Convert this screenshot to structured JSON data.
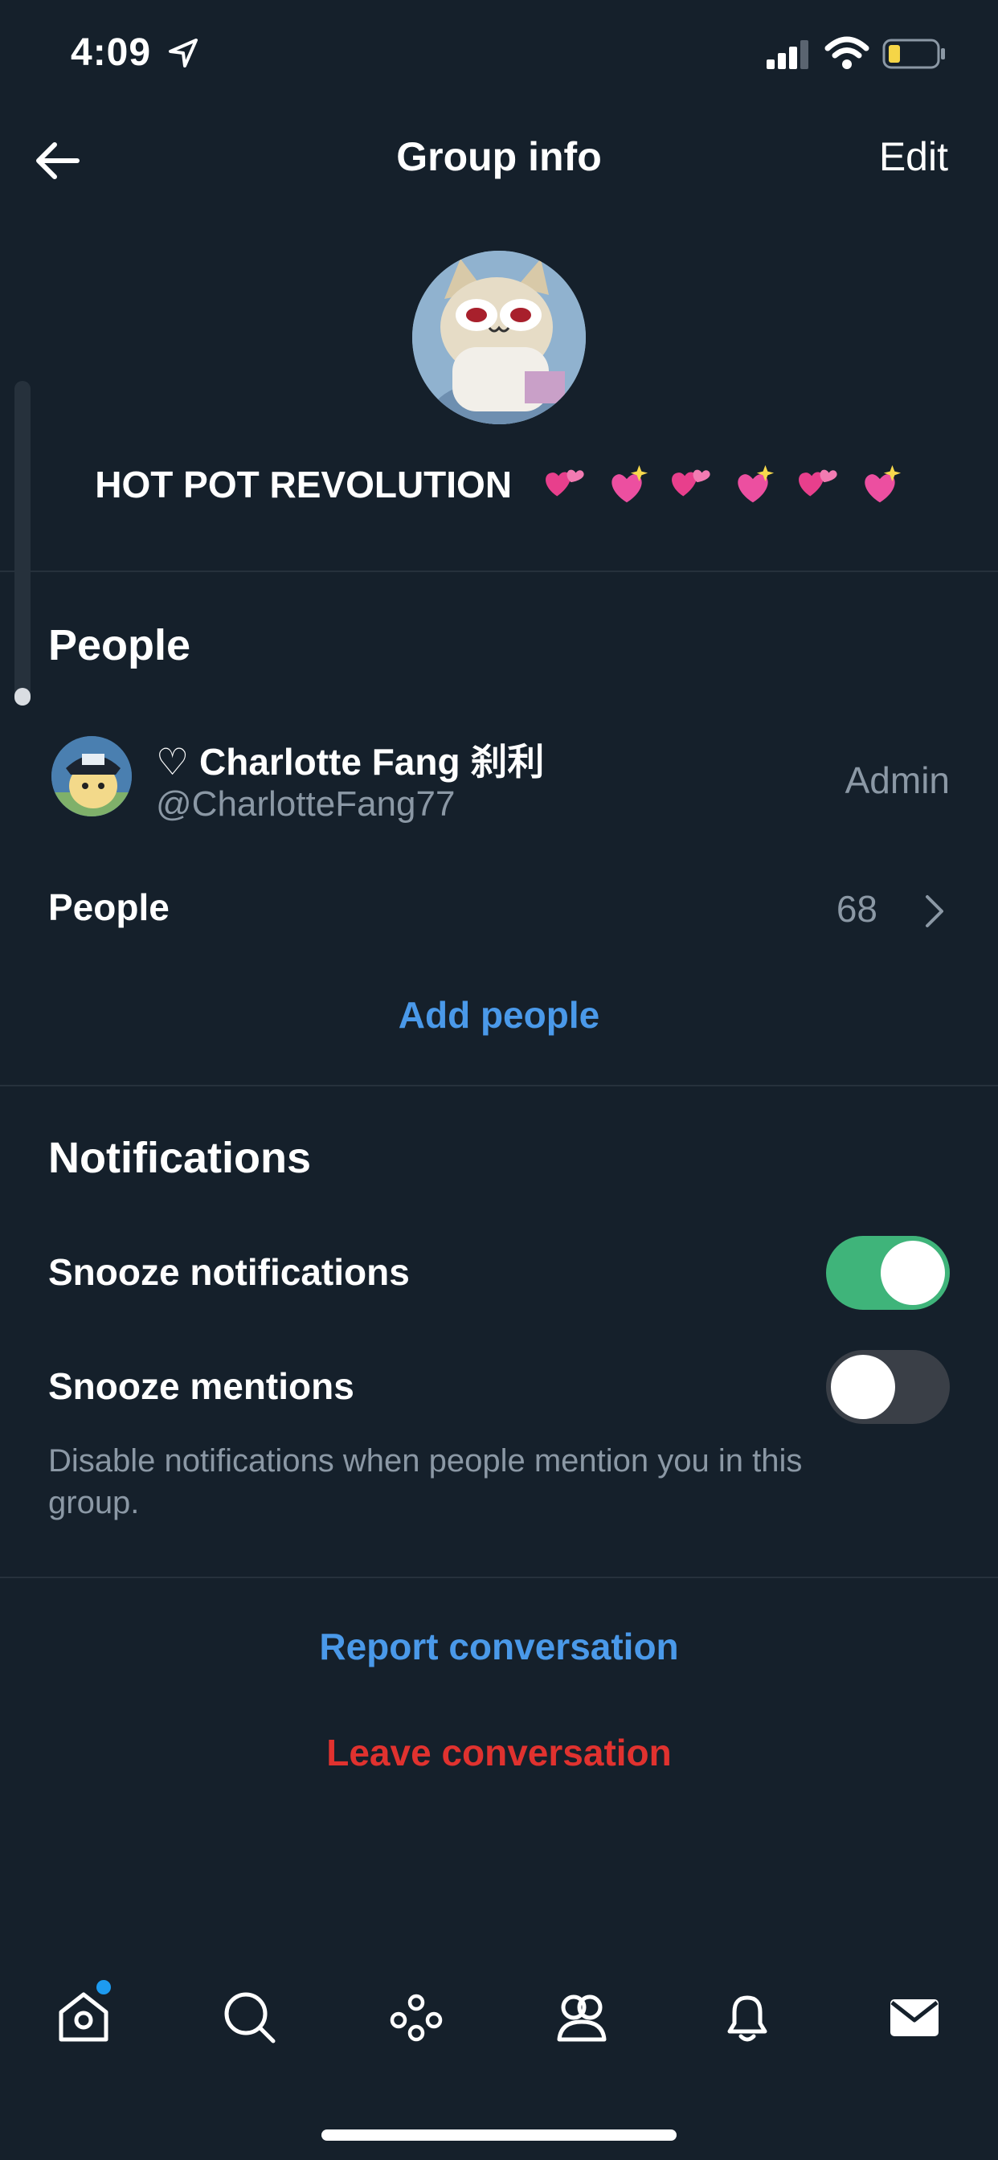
{
  "status_bar": {
    "time": "4:09"
  },
  "header": {
    "title": "Group info",
    "edit_label": "Edit"
  },
  "group": {
    "name": "HOT POT REVOLUTION"
  },
  "people_section": {
    "title": "People",
    "admin": {
      "name": "♡ Charlotte Fang 刹利",
      "handle": "@CharlotteFang77",
      "role": "Admin"
    },
    "people_label": "People",
    "people_count": "68",
    "add_people_label": "Add people"
  },
  "notifications_section": {
    "title": "Notifications",
    "snooze_notifications_label": "Snooze notifications",
    "snooze_notifications_on": true,
    "snooze_mentions_label": "Snooze mentions",
    "snooze_mentions_on": false,
    "helper_text": "Disable notifications when people mention you in this group."
  },
  "actions": {
    "report_label": "Report conversation",
    "leave_label": "Leave conversation"
  },
  "bottom_nav": {
    "items": [
      "home-icon",
      "search-icon",
      "spaces-icon",
      "communities-icon",
      "notifications-icon",
      "messages-icon"
    ]
  },
  "colors": {
    "background": "#15202b",
    "link": "#4a99e9",
    "danger": "#e0322f",
    "toggle_on": "#3fb47a"
  }
}
